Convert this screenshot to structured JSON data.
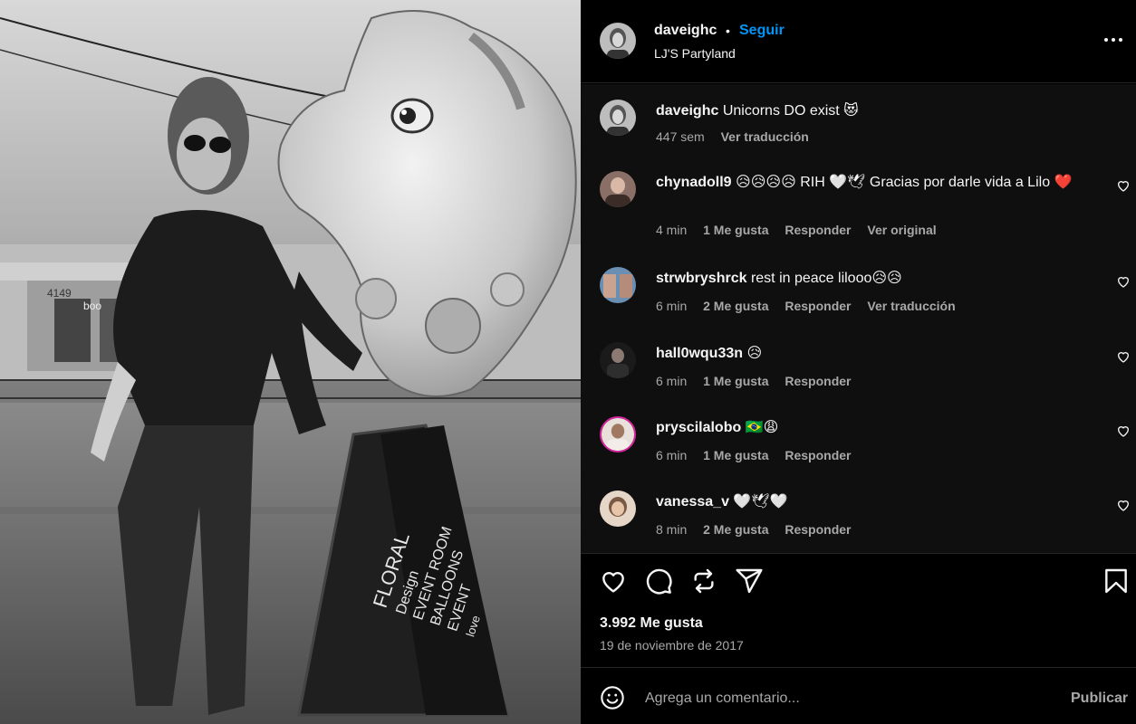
{
  "post": {
    "author": "daveighc",
    "separator": "•",
    "follow_label": "Seguir",
    "location": "LJ'S Partyland",
    "more_icon": "more-horizontal-icon",
    "caption": {
      "user": "daveighc",
      "text": "Unicorns DO exist 😻",
      "time": "447 sem",
      "translate_label": "Ver traducción"
    },
    "likes": "3.992 Me gusta",
    "date": "19 de noviembre de 2017"
  },
  "comments": [
    {
      "user": "chynadoll9",
      "text": "😥😥😥😥 RIH 🤍🕊 Gracias por darle vida a Lilo ❤️",
      "time": "4 min",
      "likes": "1 Me gusta",
      "reply": "Responder",
      "extra": "Ver original"
    },
    {
      "user": "strwbryshrck",
      "text": "rest in peace lilooo😥😥",
      "time": "6 min",
      "likes": "2 Me gusta",
      "reply": "Responder",
      "extra": "Ver traducción"
    },
    {
      "user": "hall0wqu33n",
      "text": "😥",
      "time": "6 min",
      "likes": "1 Me gusta",
      "reply": "Responder",
      "extra": ""
    },
    {
      "user": "pryscilalobo",
      "text": "🇧🇷😩",
      "time": "6 min",
      "likes": "1 Me gusta",
      "reply": "Responder",
      "extra": ""
    },
    {
      "user": "vanessa_v",
      "text": "🤍🕊🤍",
      "time": "8 min",
      "likes": "2 Me gusta",
      "reply": "Responder",
      "extra": ""
    }
  ],
  "actions": {
    "like_icon": "heart-icon",
    "comment_icon": "comment-icon",
    "repost_icon": "repost-icon",
    "share_icon": "share-icon",
    "save_icon": "bookmark-icon"
  },
  "composer": {
    "emoji_icon": "emoji-icon",
    "placeholder": "Agrega un comentario...",
    "publish_label": "Publicar"
  },
  "photo_sign_text": [
    "FLORAL",
    "Design",
    "EVENT ROOM",
    "BALLOONS",
    "EVENT",
    "love"
  ],
  "photo_storefront_text": [
    "4149",
    "boo"
  ]
}
